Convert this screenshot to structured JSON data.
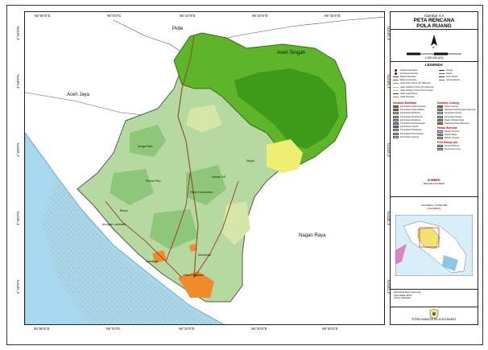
{
  "map": {
    "regions": {
      "pidie": "Pidie",
      "aceh_tengah": "Aceh Tengah",
      "aceh_jaya": "Aceh Jaya",
      "nagan_raya": "Nagan Raya"
    },
    "towns": [
      "Sungai Mas",
      "Panton Reu",
      "Pante Ceureumen",
      "Woyla",
      "Kaway XVI",
      "Bubon",
      "Arongan Lambalek",
      "Samatiga",
      "Meureubo",
      "Johan Pahlawan"
    ],
    "top_ticks": [
      "95°50'0\"E",
      "96°0'0\"E",
      "96°10'0\"E",
      "96°20'0\"E",
      "96°30'0\"E"
    ],
    "bottom_ticks": [
      "95°50'0\"E",
      "96°0'0\"E",
      "96°10'0\"E",
      "96°20'0\"E",
      "96°30'0\"E"
    ],
    "left_ticks": [
      "4°50'0\"N",
      "4°40'0\"N",
      "4°30'0\"N",
      "4°20'0\"N",
      "4°10'0\"N"
    ],
    "right_ticks": [
      "4°50'0\"N",
      "4°40'0\"N",
      "4°30'0\"N",
      "4°20'0\"N",
      "4°10'0\"N"
    ],
    "colors": {
      "protected_forest": "#3f9a1a",
      "protected_forest_light": "#5fb52a",
      "cultivation_mosaic": "#b5d9a0",
      "estate": "#8ec77a",
      "dryland": "#d6e6a8",
      "yellow_zone": "#eeee70",
      "sea": "#a8d8ee",
      "town": "#f08a2a",
      "river": "#8a5a2a",
      "road": "#a02020"
    }
  },
  "panel": {
    "figure_no": "Gambar 4.4",
    "title_line1": "PETA RENCANA",
    "title_line2": "POLA RUANG",
    "north_label": "N",
    "scale_label": "1:320.000 (A3)",
    "legend_title": "LEGENDA",
    "legend_left_top": [
      "Ibukota Kabupaten",
      "Ibukota Kecamatan",
      "Batas Kabupaten",
      "Batas Kecamatan",
      "Jalan Arteri Primer (KT Nasional)",
      "Jalan Kolektor Primer (KK Nasional)",
      "Jalan Kolektor Primer (KK Provinsi)",
      "Jalan Lokal Primer",
      "Jalan Rencana"
    ],
    "legend_right_top": [
      "Sungai",
      "Danau",
      "Garis Pantai",
      "Jalur Evakuasi"
    ],
    "budidaya_title": "Kawasan Budidaya",
    "budidaya_items": [
      "Peruntukan Hutan Produksi",
      "Peruntukan Hutan Rakyat",
      "Peruntukan Pertanian",
      "Peruntukan Perkebunan",
      "Peruntukan Perikanan",
      "Peruntukan Pertambangan",
      "Peruntukan Industri",
      "Peruntukan Pariwisata",
      "Peruntukan Permukiman",
      "Peruntukan Lainnya"
    ],
    "lindung_title": "Kawasan Lindung",
    "lindung_items": [
      "Hutan Lindung",
      "Kawasan Perlindungan Setempat",
      "Sempadan Pantai",
      "Sempadan Sungai",
      "Ruang Terbuka Hijau",
      "Kawasan Rawan Bencana"
    ],
    "rawan_title": "Rawan Bencana",
    "rawan_items": [
      "Rawan Tsunami",
      "Rawan Banjir",
      "Rawan Longsor"
    ],
    "pola_title": "Pola Ruang Laut",
    "pola_items": [
      "Zona Perikanan",
      "Zona Konservasi"
    ],
    "source_title": "SUMBER:",
    "source_text": "Bappeda Aceh Barat",
    "inset_caption": "Aceh Barat, 1:3.000.000",
    "inset_sub": "Aceh Barat",
    "references": [
      "Peta Rupa Bumi Indonesia",
      "Citra Satelit SPOT",
      "Survei Lapangan"
    ],
    "agency": "RTRW KABUPATEN ACEH BARAT"
  }
}
